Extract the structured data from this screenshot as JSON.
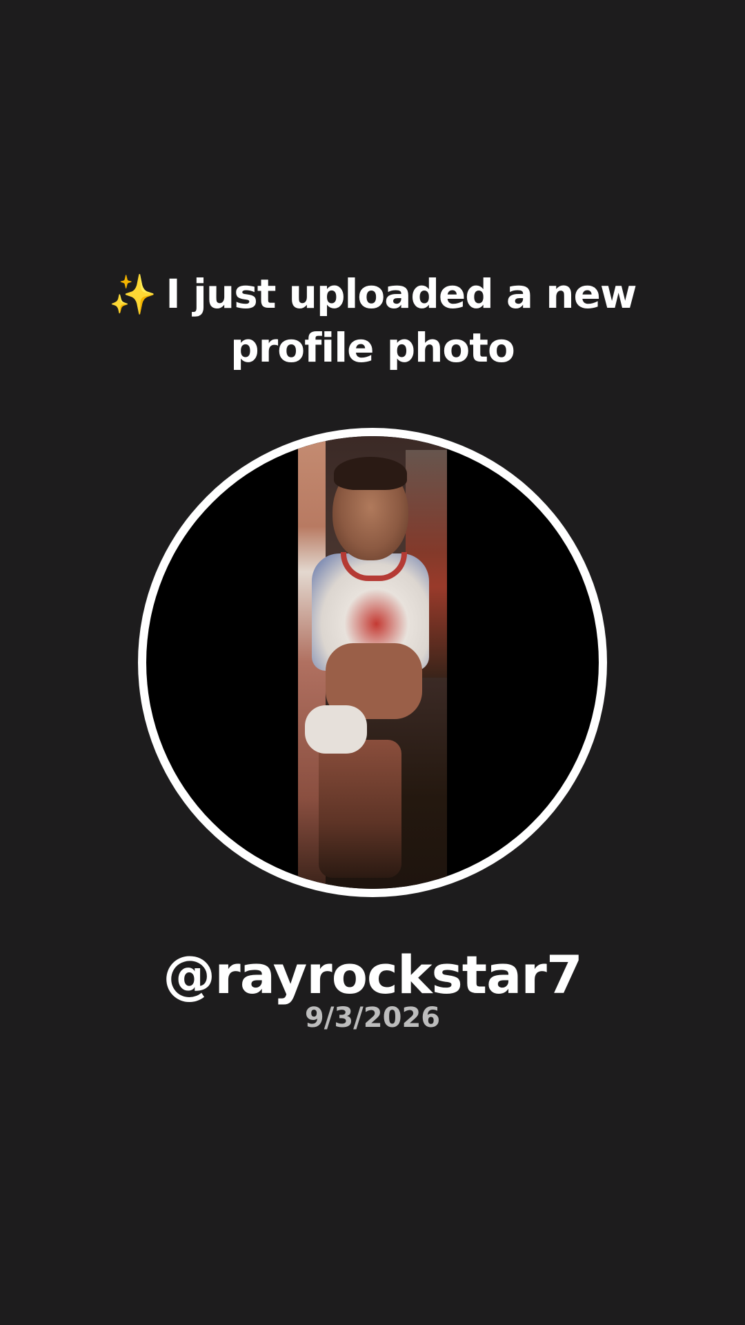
{
  "headline": {
    "icon": "sparkles-icon",
    "icon_glyph": "✨",
    "line1": "I just uploaded a new",
    "line2": "profile photo"
  },
  "profile": {
    "photo_alt": "Profile photo",
    "username": "@rayrockstar7",
    "date": "9/3/2026"
  },
  "colors": {
    "background": "#1d1c1d",
    "ring": "#ffffff",
    "text_primary": "#ffffff",
    "text_secondary": "#bdbdbd"
  }
}
